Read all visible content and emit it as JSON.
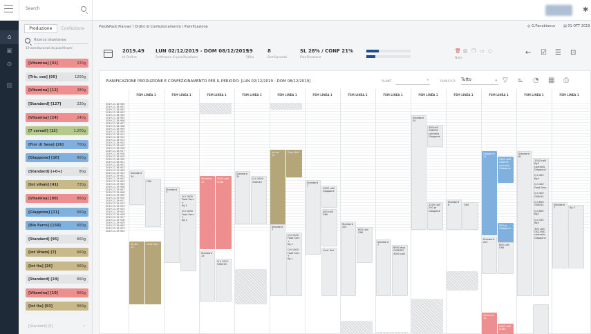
{
  "topbar": {
    "search_placeholder": "Search"
  },
  "side": {
    "tab_active": "Produzione",
    "tab_inactive": "Confezione",
    "search_placeholder": "Ricerca istantanea",
    "note": "19 semilavorati da pianificare:",
    "items": [
      {
        "label": "[Vitamina] [41]",
        "qty": "220g",
        "color": "red"
      },
      {
        "label": "[Tric. cee] [95]",
        "qty": "1200g",
        "color": "gray"
      },
      {
        "label": "[Vitamina] [12]",
        "qty": "280g",
        "color": "red"
      },
      {
        "label": "[Standard] [127]",
        "qty": "220g",
        "color": "gray"
      },
      {
        "label": "[Vitamina] [24]",
        "qty": "240g",
        "color": "red"
      },
      {
        "label": "[7 cereali] [12]",
        "qty": "1.200g",
        "color": "green"
      },
      {
        "label": "[Fior di Sesa] [26]",
        "qty": "700g",
        "color": "blue"
      },
      {
        "label": "[Giappone] [10]",
        "qty": "660g",
        "color": "blue"
      },
      {
        "label": "[Standard] [+0+]",
        "qty": "80g",
        "color": "gray"
      },
      {
        "label": "[Int vitam] [41]",
        "qty": "720g",
        "color": "khaki"
      },
      {
        "label": "[Vitamina] [90]",
        "qty": "860g",
        "color": "red"
      },
      {
        "label": "[Giappone] [11]",
        "qty": "660g",
        "color": "blue"
      },
      {
        "label": "[Bio Farro] [150]",
        "qty": "660g",
        "color": "blue"
      },
      {
        "label": "[Standard] [95]",
        "qty": "660g",
        "color": "gray"
      },
      {
        "label": "[Int Vitam] [7]",
        "qty": "660g",
        "color": "khaki"
      },
      {
        "label": "[Int Ita] [26]",
        "qty": "660g",
        "color": "khaki"
      },
      {
        "label": "[Standard] [24]",
        "qty": "660g",
        "color": "gray"
      },
      {
        "label": "[Vitamina] [10]",
        "qty": "660g",
        "color": "red"
      },
      {
        "label": "[Int Ita] [93]",
        "qty": "660g",
        "color": "khaki"
      },
      {
        "label": "[Standard] [6]",
        "qty": "✓",
        "color": "faded"
      }
    ]
  },
  "breadcrumb": "Pred&Pack Planner \\ Ordini di Confezionamento \\ Pianificazione",
  "user": "G.Panebianco",
  "date": "01 OTT 2019",
  "order": {
    "id": "2019.49",
    "id_label": "Id Ordine",
    "week": "LUN 02/12/2019 - DOM 08/12/2019",
    "week_label": "Settimana di pianificazione",
    "skus": "19",
    "skus_label": "SKUs",
    "semi": "8",
    "semi_label": "Semilavorati",
    "plan": "SL 28% / CONF 21%",
    "plan_label": "Pianificazione",
    "progress_sl": 0.28,
    "progress_conf": 0.21,
    "note_label": "Note"
  },
  "card": {
    "title": "PIANIFICAZIONE PRODUZIONE E CONFEZIONAMENTO PER IL PERIODO: [LUN 02/12/2019 - DOM 08/12/2019]",
    "plant_label": "PLANT",
    "pianifica_label": "PIANIFICA",
    "pianifica_value": "Tutto"
  },
  "grid": {
    "column_label": "FSM LINEA 1",
    "times": [
      "2019.11.18 H00",
      "2019.11.18 H01",
      "2019.11.18 H02",
      "2019.11.18 H03",
      "2019.11.18 H04",
      "2019.11.18 H05",
      "2019.11.18 H06",
      "2019.11.18 H07",
      "2019.11.18 H08",
      "2019.11.18 H09",
      "2019.11.18 H10",
      "2019.11.18 H11",
      "2019.11.18 H12",
      "2019.11.18 H13",
      "2019.11.18 H14",
      "2019.11.18 H15",
      "2019.11.18 H16",
      "2019.11.18 H17",
      "2019.11.18 H18",
      "2019.11.18 H19",
      "2019.11.18 H20",
      "2019.11.18 H21",
      "2019.11.18 H22",
      "2019.11.18 H23",
      "2019.11.19 H00",
      "2019.11.19 H01",
      "2019.11.19 H02",
      "2019.11.19 H03",
      "2019.11.19 H04",
      "2019.11.19 H05",
      "2019.11.19 H06",
      "2019.11.19 H07",
      "2019.11.19 H08",
      "2019.11.19 H09",
      "2019.11.19 H10",
      "2019.11.19 H11",
      "2019.11.19 H12",
      "2019.11.19 H13",
      "2019.11.19 H14",
      "2019.11.19 H15",
      "2019.11.19 H16",
      "2019.11.19 H17",
      "2019.11.19 H18",
      "2019.11.19 H19",
      "2019.11.19 H20",
      "2019.11.19 H21",
      "2019.11.19 H22"
    ],
    "blocks": [
      {
        "col": 0,
        "start": 24.6,
        "end": 37,
        "type": "gray",
        "text": "Standard\n34",
        "half": "left"
      },
      {
        "col": 0,
        "start": 27.6,
        "end": 45,
        "type": "gray",
        "text": "CN0",
        "half": "right"
      },
      {
        "col": 0,
        "start": 50.2,
        "end": 73,
        "type": "khaki",
        "text": "Int.ita\n12",
        "half": "left"
      },
      {
        "col": 0,
        "start": 50.2,
        "end": 73,
        "type": "khaki",
        "text": "Conf. Std.",
        "half": "right"
      },
      {
        "col": 1,
        "start": 30.5,
        "end": 58,
        "type": "gray",
        "text": "Standard\n7",
        "half": "left"
      },
      {
        "col": 1,
        "start": 33,
        "end": 61,
        "type": "gray",
        "text": "Q.li 1000\nFood Serv\n+\nKg 1\n\nQ.li 1000\nFood Serv\n+\nKg 1",
        "half": "right"
      },
      {
        "col": 2,
        "start": 0,
        "end": 4,
        "type": "hatch",
        "text": "",
        "half": "full"
      },
      {
        "col": 2,
        "start": 26.6,
        "end": 53,
        "type": "red",
        "text": "Vitamina\n12",
        "half": "left"
      },
      {
        "col": 2,
        "start": 26.6,
        "end": 53,
        "type": "red",
        "text": "2000 colli\nSUBS",
        "half": "right"
      },
      {
        "col": 2,
        "start": 53.5,
        "end": 72,
        "type": "gray",
        "text": "Standard\n15",
        "half": "left"
      },
      {
        "col": 2,
        "start": 56.5,
        "end": 72,
        "type": "gray",
        "text": "Q.li 1000\nGSK015",
        "half": "right"
      },
      {
        "col": 3,
        "start": 24.8,
        "end": 44,
        "type": "gray",
        "text": "Standard\n15",
        "half": "left"
      },
      {
        "col": 3,
        "start": 26.6,
        "end": 44,
        "type": "gray",
        "text": "Q.li 1000\nGSK015",
        "half": "right"
      },
      {
        "col": 3,
        "start": 60.3,
        "end": 73,
        "type": "hatch",
        "text": "",
        "half": "full"
      },
      {
        "col": 4,
        "start": 0,
        "end": 2.5,
        "type": "hatch",
        "text": "",
        "half": "full"
      },
      {
        "col": 4,
        "start": 17,
        "end": 46,
        "type": "khaki",
        "text": "Int.ita\n12",
        "half": "left"
      },
      {
        "col": 4,
        "start": 17,
        "end": 27,
        "type": "khaki",
        "text": "Conf. Std.",
        "half": "right"
      },
      {
        "col": 4,
        "start": 44,
        "end": 70,
        "type": "gray",
        "text": "Standard\n7",
        "half": "left"
      },
      {
        "col": 4,
        "start": 47,
        "end": 70,
        "type": "gray",
        "text": "Q.li 1000\nFood Serv\n+\nKg 1\n\nQ.li 1000\nFood Serv\n+\nKg 1",
        "half": "right"
      },
      {
        "col": 5,
        "start": 28,
        "end": 55,
        "type": "gray",
        "text": "Standard\n1",
        "half": "left"
      },
      {
        "col": 5,
        "start": 30,
        "end": 38,
        "type": "gray",
        "text": "1000 colli\nGiappone",
        "half": "right"
      },
      {
        "col": 5,
        "start": 38.5,
        "end": 52,
        "type": "gray",
        "text": "400 colli\nCN0",
        "half": "right"
      },
      {
        "col": 5,
        "start": 52.5,
        "end": 70,
        "type": "gray",
        "text": "Conf. Std.",
        "half": "right"
      },
      {
        "col": 5,
        "start": 84,
        "end": 88,
        "type": "hatch",
        "text": "",
        "half": "full"
      },
      {
        "col": 6,
        "start": 43,
        "end": 70,
        "type": "gray",
        "text": "Standard\n201",
        "half": "left"
      },
      {
        "col": 6,
        "start": 45,
        "end": 58,
        "type": "gray",
        "text": "600 colli\nCN0",
        "half": "right"
      },
      {
        "col": 6,
        "start": 79,
        "end": 88,
        "type": "hatch",
        "text": "",
        "half": "full"
      },
      {
        "col": 7,
        "start": 49.5,
        "end": 70,
        "type": "gray",
        "text": "Standard\n7",
        "half": "left"
      },
      {
        "col": 7,
        "start": 51.5,
        "end": 70,
        "type": "gray",
        "text": "6000 disp\nOVERSI2\n3000 colli",
        "half": "right"
      },
      {
        "col": 7,
        "start": 83,
        "end": 88,
        "type": "hatch",
        "text": "",
        "half": "full"
      },
      {
        "col": 8,
        "start": 4.5,
        "end": 46,
        "type": "gray",
        "text": "Standard\n34",
        "half": "left"
      },
      {
        "col": 8,
        "start": 8,
        "end": 16,
        "type": "gray",
        "text": "400colli\nGSK034\ncontrollo\nGiappone",
        "half": "right"
      },
      {
        "col": 8,
        "start": 36,
        "end": 46,
        "type": "gray",
        "text": "1200 colli\n200 gr\nGiappone",
        "half": "right"
      },
      {
        "col": 8,
        "start": 71,
        "end": 88,
        "type": "hatch",
        "text": "",
        "half": "full"
      },
      {
        "col": 9,
        "start": 35,
        "end": 46,
        "type": "gray",
        "text": "Standard\n6",
        "half": "left"
      },
      {
        "col": 9,
        "start": 36,
        "end": 46,
        "type": "gray",
        "text": "CN0",
        "half": "right"
      },
      {
        "col": 9,
        "start": 61,
        "end": 68,
        "type": "hatch",
        "text": "",
        "half": "full"
      },
      {
        "col": 10,
        "start": 17.5,
        "end": 48,
        "type": "blue",
        "text": "Giappone\n11",
        "half": "left"
      },
      {
        "col": 10,
        "start": 19.5,
        "end": 29,
        "type": "blue",
        "text": "2900 colli\nGSK931\ncontrollo\nGiappone",
        "half": "right"
      },
      {
        "col": 10,
        "start": 43.5,
        "end": 53,
        "type": "blue",
        "text": "500 gr\nGiappone",
        "half": "right"
      },
      {
        "col": 10,
        "start": 48.5,
        "end": 62,
        "type": "gray",
        "text": "Standard\n201",
        "half": "left"
      },
      {
        "col": 10,
        "start": 50.5,
        "end": 62,
        "type": "gray",
        "text": "600 colli\nCN0",
        "half": "right"
      },
      {
        "col": 10,
        "start": 76,
        "end": 88,
        "type": "red",
        "text": "Vitamina\n12",
        "half": "left"
      },
      {
        "col": 10,
        "start": 80,
        "end": 88,
        "type": "red",
        "text": "2900 colli\nSUBS",
        "half": "right"
      },
      {
        "col": 11,
        "start": 17.5,
        "end": 70,
        "type": "gray",
        "text": "Standard\n61",
        "half": "left"
      },
      {
        "col": 11,
        "start": 20,
        "end": 70,
        "type": "gray",
        "text": "1200 colli\nKg3\ncontrollo\nGiappone\n\nQ.li 400\nKg3\n\nQ.li 400\nFood Serv\n\nQ.li 400\nGSK041\n\nQ.li 600\nGSK041\n\nQ.li 600\nKg3\n\nQ.li 150\nKg3\n\n300 colli\nGSC2941\ncontrollo\nGiappone",
        "half": "right"
      },
      {
        "col": 11,
        "start": 73,
        "end": 88,
        "type": "gray",
        "text": "",
        "half": "right"
      },
      {
        "col": 12,
        "start": 36,
        "end": 60,
        "type": "gray",
        "text": "Standard\n7",
        "half": "left"
      },
      {
        "col": 12,
        "start": 37,
        "end": 60,
        "type": "gray",
        "text": "Kg 3",
        "half": "right"
      }
    ]
  }
}
